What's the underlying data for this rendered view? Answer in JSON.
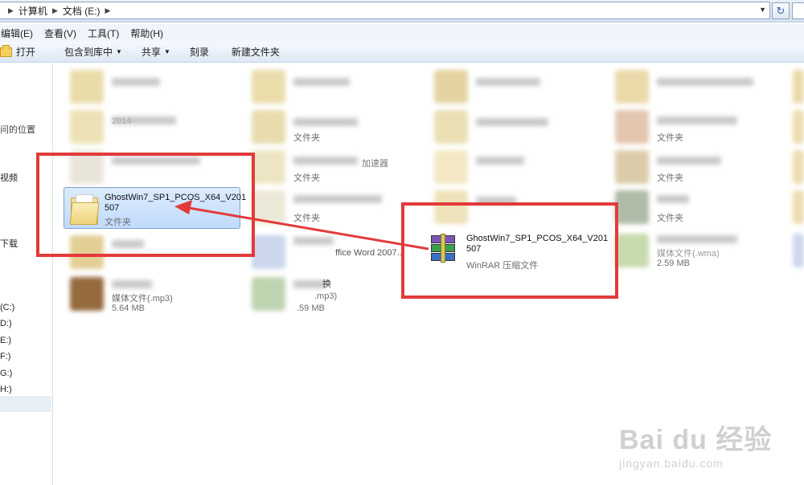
{
  "address_bar": {
    "crumbs": [
      "计算机",
      "文档 (E:)"
    ],
    "refresh_icon": "refresh-icon"
  },
  "menu": {
    "items": [
      "编辑(E)",
      "查看(V)",
      "工具(T)",
      "帮助(H)"
    ]
  },
  "toolbar": {
    "open_label": "打开",
    "include_library_label": "包含到库中",
    "share_label": "共享",
    "burn_label": "刻录",
    "new_folder_label": "新建文件夹"
  },
  "nav_pane": {
    "items": [
      "问的位置",
      "视频",
      "下载",
      "(C:)",
      "D:)",
      "E:)",
      "F:)",
      "G:)",
      "H:)"
    ],
    "selected": "E:)"
  },
  "files": {
    "folder_type": "文件夹",
    "folder_selected": {
      "name": "GhostWin7_SP1_PCOS_X64_V201507",
      "name_line1": "GhostWin7_SP1_PCOS_X64_V201",
      "name_line2": "507",
      "type": "文件夹"
    },
    "rar_file": {
      "name_line1": "GhostWin7_SP1_PCOS_X64_V201",
      "name_line2": "507",
      "type": "WinRAR 压缩文件"
    },
    "word_doc_type": "ffice Word 2007...",
    "media_wma": {
      "type": "媒体文件(.wma)",
      "size": "2.59 MB"
    },
    "media_mp3_a": {
      "type": "媒体文件(.mp3)",
      "size": "5.64 MB"
    },
    "media_mp3_b": {
      "type": ".mp3)",
      "size": ".59 MB"
    },
    "partial_text_a": "2014",
    "partial_text_b": "换",
    "partial_text_c": "加速器"
  },
  "watermark": {
    "text": "Bai du 经验",
    "url": "jingyan.baidu.com"
  },
  "colors": {
    "highlight_red": "#e23a3a",
    "selection_blue": "#c1dbfc"
  }
}
